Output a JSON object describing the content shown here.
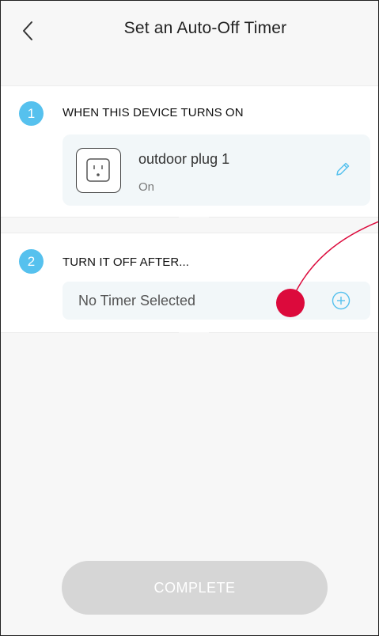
{
  "header": {
    "title": "Set an Auto-Off Timer",
    "back_icon": "chevron-left-icon"
  },
  "step1": {
    "number": "1",
    "label": "WHEN THIS DEVICE TURNS ON",
    "device": {
      "name": "outdoor plug 1",
      "status": "On",
      "icon": "outlet-icon",
      "edit_icon": "pencil-icon"
    }
  },
  "step2": {
    "number": "2",
    "label": "TURN IT OFF AFTER...",
    "timer": {
      "placeholder": "No Timer Selected",
      "add_icon": "plus-circle-icon"
    }
  },
  "complete_button": {
    "label": "COMPLETE",
    "enabled": false
  },
  "colors": {
    "accent": "#56c1ee",
    "background": "#f7f7f7",
    "card": "#f2f7f9",
    "button_disabled": "#d6d6d6",
    "annotation": "#dc0a3c"
  }
}
